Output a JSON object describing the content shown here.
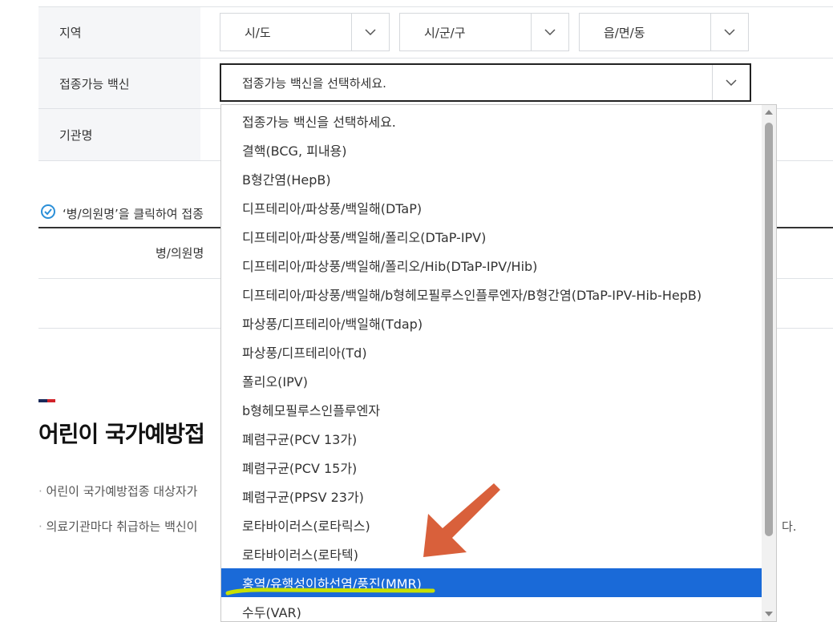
{
  "form": {
    "region_label": "지역",
    "vaccine_label": "접종가능 백신",
    "org_label": "기관명",
    "sido": "시/도",
    "sigungu": "시/군/구",
    "eupmyeondong": "읍/면/동",
    "vaccine_value": "접종가능 백신을 선택하세요."
  },
  "notice": "‘병/의원명’을 클릭하여 접종",
  "table": {
    "col_hospital": "병/의원명"
  },
  "section": {
    "title": "어린이 국가예방접",
    "bullet1": "어린이 국가예방접종 대상자가",
    "bullet2": "의료기관마다 취급하는 백신이",
    "bullet2_tail": "다."
  },
  "dropdown": {
    "options": [
      "접종가능 백신을 선택하세요.",
      "결핵(BCG, 피내용)",
      "B형간염(HepB)",
      "디프테리아/파상풍/백일해(DTaP)",
      "디프테리아/파상풍/백일해/폴리오(DTaP-IPV)",
      "디프테리아/파상풍/백일해/폴리오/Hib(DTaP-IPV/Hib)",
      "디프테리아/파상풍/백일해/b형헤모필루스인플루엔자/B형간염(DTaP-IPV-Hib-HepB)",
      "파상풍/디프테리아/백일해(Tdap)",
      "파상풍/디프테리아(Td)",
      "폴리오(IPV)",
      "b형헤모필루스인플루엔자",
      "폐렴구균(PCV 13가)",
      "폐렴구균(PCV 15가)",
      "폐렴구균(PPSV 23가)",
      "로타바이러스(로타릭스)",
      "로타바이러스(로타텍)",
      "홍역/유행성이하선염/풍진(MMR)",
      "수두(VAR)"
    ],
    "selected_index": 16
  },
  "colors": {
    "selected_bg": "#1a6ad8",
    "arrow": "#d9603b",
    "underline": "#c8e000",
    "accent_navy": "#1b2a5a",
    "accent_red": "#d2232a"
  }
}
